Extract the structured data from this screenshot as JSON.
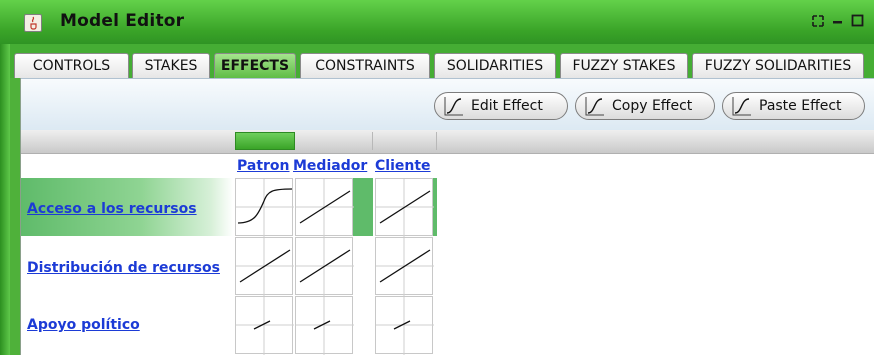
{
  "window": {
    "title": "Model Editor",
    "accent_color": "#4fb13a",
    "controls": [
      "restore-icon",
      "minimize-icon",
      "maximize-icon"
    ]
  },
  "tabs": [
    {
      "label": "CONTROLS",
      "active": false
    },
    {
      "label": "STAKES",
      "active": false
    },
    {
      "label": "EFFECTS",
      "active": true
    },
    {
      "label": "CONSTRAINTS",
      "active": false
    },
    {
      "label": "SOLIDARITIES",
      "active": false
    },
    {
      "label": "FUZZY STAKES",
      "active": false
    },
    {
      "label": "FUZZY SOLIDARITIES",
      "active": false
    }
  ],
  "toolbar": {
    "edit_label": "Edit Effect",
    "copy_label": "Copy Effect",
    "paste_label": "Paste Effect"
  },
  "grid": {
    "columns": [
      "Patron",
      "Mediador",
      "Cliente"
    ],
    "rows": [
      {
        "label": "Acceso a los recursos",
        "curves": [
          "sigmoid",
          "linear",
          "linear"
        ],
        "selected": true
      },
      {
        "label": "Distribución de recursos",
        "curves": [
          "linear",
          "linear",
          "linear"
        ],
        "selected": false
      },
      {
        "label": "Apoyo político",
        "curves": [
          "short",
          "short",
          "short"
        ],
        "selected": false
      }
    ],
    "link_color": "#1c3bd6",
    "selection_color": "#5fbb6a"
  }
}
